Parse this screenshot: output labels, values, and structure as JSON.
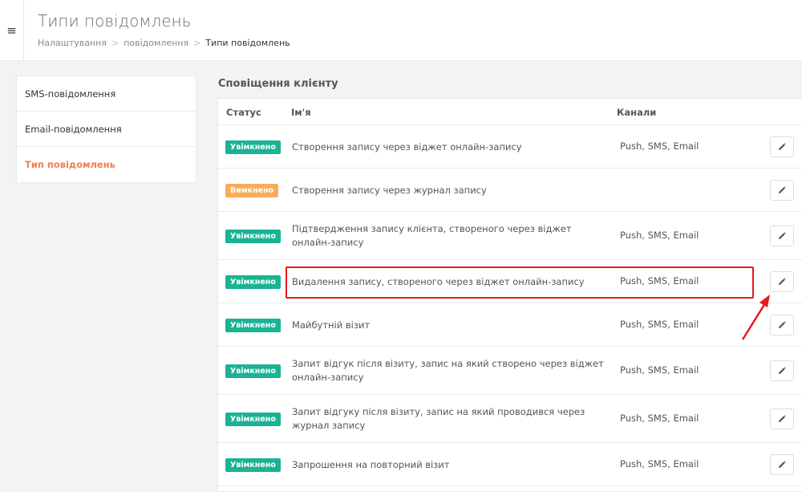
{
  "header": {
    "menu_icon_glyph": "≡",
    "title": "Типи повідомлень",
    "breadcrumb": {
      "items": [
        "Налаштування",
        "повідомлення"
      ],
      "separator": ">",
      "current": "Типи повідомлень"
    }
  },
  "sidebar": {
    "items": [
      {
        "label": "SMS-повідомлення",
        "active": false
      },
      {
        "label": "Email-повідомлення",
        "active": false
      },
      {
        "label": "Тип повідомлень",
        "active": true
      }
    ]
  },
  "section": {
    "title": "Сповіщення клієнту",
    "columns": {
      "status": "Статус",
      "name": "Ім'я",
      "channels": "Канали"
    }
  },
  "rows": [
    {
      "status": "Увімкнено",
      "status_type": "on",
      "name": "Створення запису через віджет онлайн-запису",
      "channels": "Push, SMS, Email"
    },
    {
      "status": "Вимкнено",
      "status_type": "off",
      "name": "Створення запису через журнал запису",
      "channels": ""
    },
    {
      "status": "Увімкнено",
      "status_type": "on",
      "name": "Підтвердження запису клієнта, створеного через віджет онлайн-запису",
      "channels": "Push, SMS, Email"
    },
    {
      "status": "Увімкнено",
      "status_type": "on",
      "name": "Видалення запису, створеного через віджет онлайн-запису",
      "channels": "Push, SMS, Email",
      "highlighted": true
    },
    {
      "status": "Увімкнено",
      "status_type": "on",
      "name": "Майбутній візит",
      "channels": "Push, SMS, Email"
    },
    {
      "status": "Увімкнено",
      "status_type": "on",
      "name": "Запит відгук після візиту, запис на який створено через віджет онлайн-запису",
      "channels": "Push, SMS, Email"
    },
    {
      "status": "Увімкнено",
      "status_type": "on",
      "name": "Запит відгуку після візиту, запис на який проводився через журнал запису",
      "channels": "Push, SMS, Email"
    },
    {
      "status": "Увімкнено",
      "status_type": "on",
      "name": "Запрошення на повторний візит",
      "channels": "Push, SMS, Email"
    }
  ],
  "icons": {
    "edit": "pencil-icon",
    "menu": "hamburger-icon"
  },
  "colors": {
    "status_on": "#1ab394",
    "status_off": "#f8ac59",
    "active_nav": "#f0804c",
    "annotation": "#e8191c"
  }
}
